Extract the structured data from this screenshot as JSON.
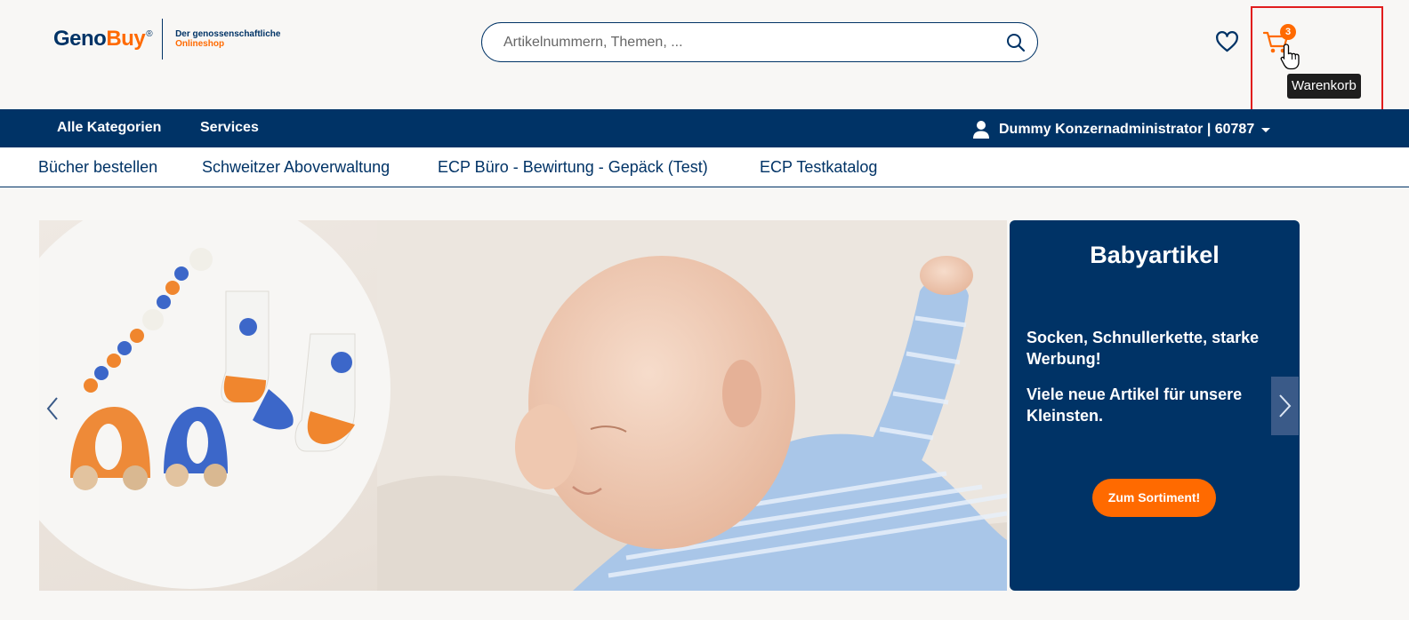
{
  "header": {
    "logo": {
      "geno": "Geno",
      "buy": "Buy",
      "reg": "®",
      "tagline_1": "Der genossenschaftliche",
      "tagline_2": "Onlineshop"
    },
    "search": {
      "placeholder": "Artikelnummern, Themen, ...",
      "value": ""
    },
    "cart": {
      "count": "3",
      "tooltip": "Warenkorb"
    },
    "icons": {
      "search": "search-icon",
      "wishlist": "heart-icon",
      "cart": "cart-icon"
    }
  },
  "navbar": {
    "items": [
      {
        "label": "Alle Kategorien"
      },
      {
        "label": "Services"
      }
    ],
    "user": "Dummy Konzernadministrator | 60787"
  },
  "subnav": {
    "items": [
      {
        "label": "Bücher bestellen"
      },
      {
        "label": "Schweitzer Aboverwaltung"
      },
      {
        "label": "ECP Büro - Bewirtung - Gepäck (Test)"
      },
      {
        "label": "ECP Testkatalog"
      }
    ]
  },
  "hero": {
    "title": "Babyartikel",
    "text_1": "Socken, Schnullerkette, starke Werbung!",
    "text_2": "Viele neue Artikel für unsere Kleinsten.",
    "cta": "Zum Sortiment!"
  },
  "colors": {
    "primary": "#003366",
    "accent": "#ff6a00",
    "highlight": "#e11d1d"
  }
}
